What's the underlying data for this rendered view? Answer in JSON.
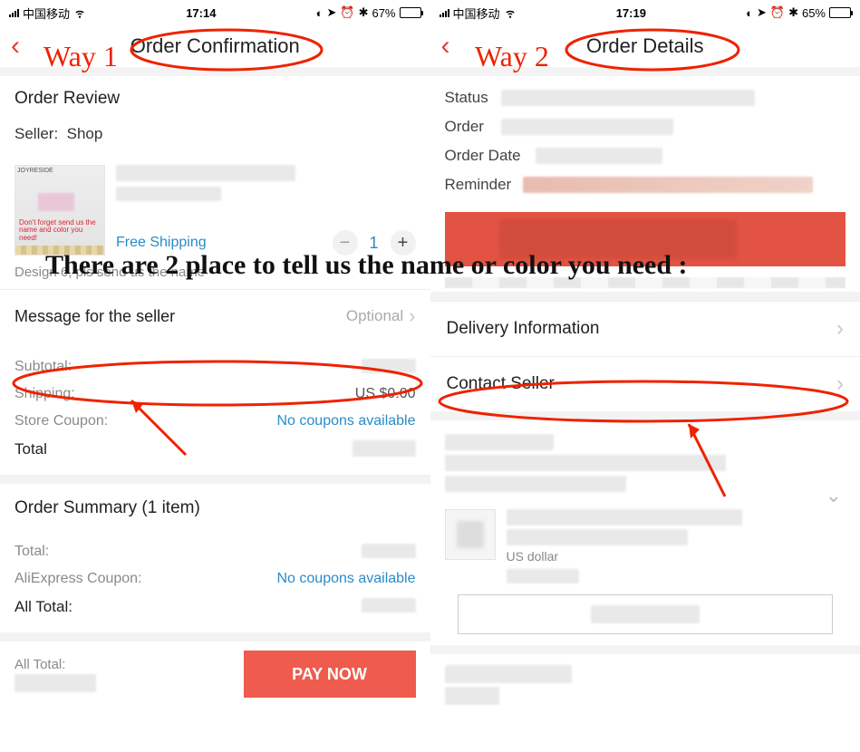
{
  "annotations": {
    "way1": "Way 1",
    "way2": "Way 2",
    "banner": "There are 2 place to tell us the name or color you need :"
  },
  "screen1": {
    "status": {
      "carrier": "中国移动",
      "time": "17:14",
      "battery_pct": "67%",
      "battery_fill": 67
    },
    "nav_title": "Order Confirmation",
    "review_title": "Order Review",
    "seller_prefix": "Seller:",
    "seller_name": "Shop",
    "thumb_brand": "JOYRESIDE",
    "thumb_note": "Don't forget send us the name and color you need!",
    "free_shipping": "Free Shipping",
    "qty": "1",
    "variant_note": "Design 6, pls send us the name",
    "msg_row_label": "Message for the seller",
    "msg_row_hint": "Optional",
    "lines": {
      "subtotal": "Subtotal:",
      "shipping": "Shipping:",
      "shipping_val": "US $0.00",
      "store_coupon": "Store Coupon:",
      "no_coupons": "No coupons available",
      "total": "Total"
    },
    "summary_title": "Order Summary (1 item)",
    "summary": {
      "total": "Total:",
      "ali_coupon": "AliExpress Coupon:",
      "all_total": "All Total:"
    },
    "footer_all_total": "All Total:",
    "pay_btn": "PAY NOW"
  },
  "screen2": {
    "status": {
      "carrier": "中国移动",
      "time": "17:19",
      "battery_pct": "65%",
      "battery_fill": 65
    },
    "nav_title": "Order Details",
    "kv": {
      "status": "Status",
      "order": "Order",
      "order_date": "Order Date",
      "reminder": "Reminder"
    },
    "rows": {
      "delivery": "Delivery Information",
      "contact": "Contact Seller"
    },
    "currency_note": "US dollar"
  }
}
